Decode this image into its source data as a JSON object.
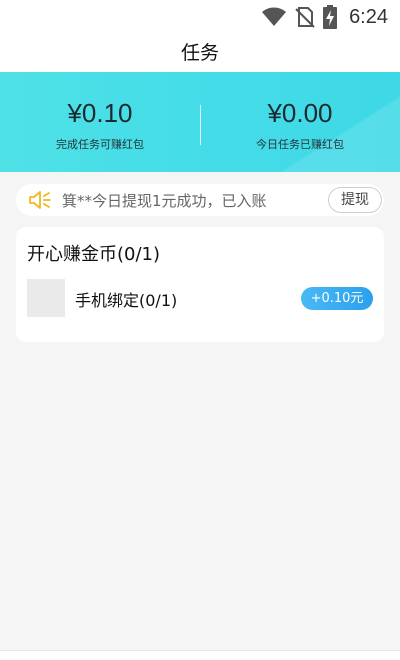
{
  "status_bar": {
    "time": "6:24",
    "icons": [
      "wifi-icon",
      "no-sim-icon",
      "battery-charging-icon"
    ]
  },
  "header": {
    "title": "任务"
  },
  "banner": {
    "left": {
      "value": "¥0.10",
      "label": "完成任务可赚红包"
    },
    "right": {
      "value": "¥0.00",
      "label": "今日任务已赚红包"
    },
    "gradient_colors": [
      "#4fe1e6",
      "#3ed8e6"
    ]
  },
  "notice": {
    "icon": "speaker-icon",
    "text": "箕**今日提现1元成功，已入账",
    "button_label": "提现",
    "icon_color": "#f2b820"
  },
  "task_section": {
    "title": "开心赚金币(0/1)",
    "tasks": [
      {
        "name": "手机绑定(0/1)",
        "reward": "+0.10元"
      }
    ],
    "reward_color": "#2aa1ee"
  }
}
